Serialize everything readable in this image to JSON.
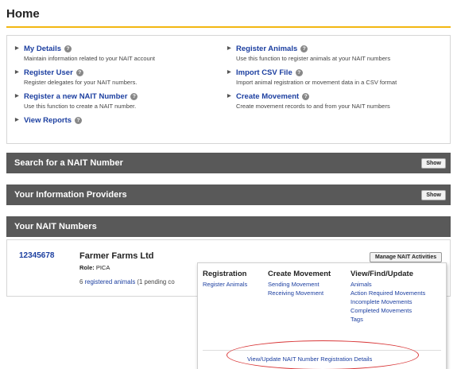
{
  "page": {
    "title": "Home"
  },
  "menu": {
    "left": [
      {
        "label": "My Details",
        "desc": "Maintain information related to your NAIT account"
      },
      {
        "label": "Register User",
        "desc": "Register delegates for your NAIT numbers."
      },
      {
        "label": "Register a new NAIT Number",
        "desc": "Use this function to create a NAIT number."
      },
      {
        "label": "View Reports",
        "desc": ""
      }
    ],
    "right": [
      {
        "label": "Register Animals",
        "desc": "Use this function to register animals at your NAIT numbers"
      },
      {
        "label": "Import CSV File",
        "desc": "Import animal registration or movement data in a CSV format"
      },
      {
        "label": "Create Movement",
        "desc": "Create movement records to and from your NAIT numbers"
      }
    ],
    "help_glyph": "?"
  },
  "sections": {
    "search": {
      "title": "Search for a NAIT Number",
      "button": "Show"
    },
    "providers": {
      "title": "Your Information Providers",
      "button": "Show"
    },
    "numbers": {
      "title": "Your NAIT Numbers"
    }
  },
  "nait": {
    "number": "12345678",
    "farm": "Farmer Farms Ltd",
    "role_label": "Role:",
    "role_value": "PICA",
    "count": "6",
    "registered_link": "registered animals",
    "pending_text": "(1 pending co",
    "manage_button": "Manage NAIT Activities"
  },
  "popup": {
    "registration": {
      "title": "Registration",
      "links": [
        "Register Animals"
      ]
    },
    "create_movement": {
      "title": "Create Movement",
      "links": [
        "Sending Movement",
        "Receiving Movement"
      ]
    },
    "view": {
      "title": "View/Find/Update",
      "links": [
        "Animals",
        "Action Required Movements",
        "Incomplete Movements",
        "Completed Movements",
        "Tags"
      ]
    },
    "footer_link": "View/Update NAIT Number Registration Details"
  },
  "colors": {
    "accent": "#f3b712",
    "bar": "#595959",
    "link": "#1c3fa0",
    "highlight": "#d9393a"
  }
}
